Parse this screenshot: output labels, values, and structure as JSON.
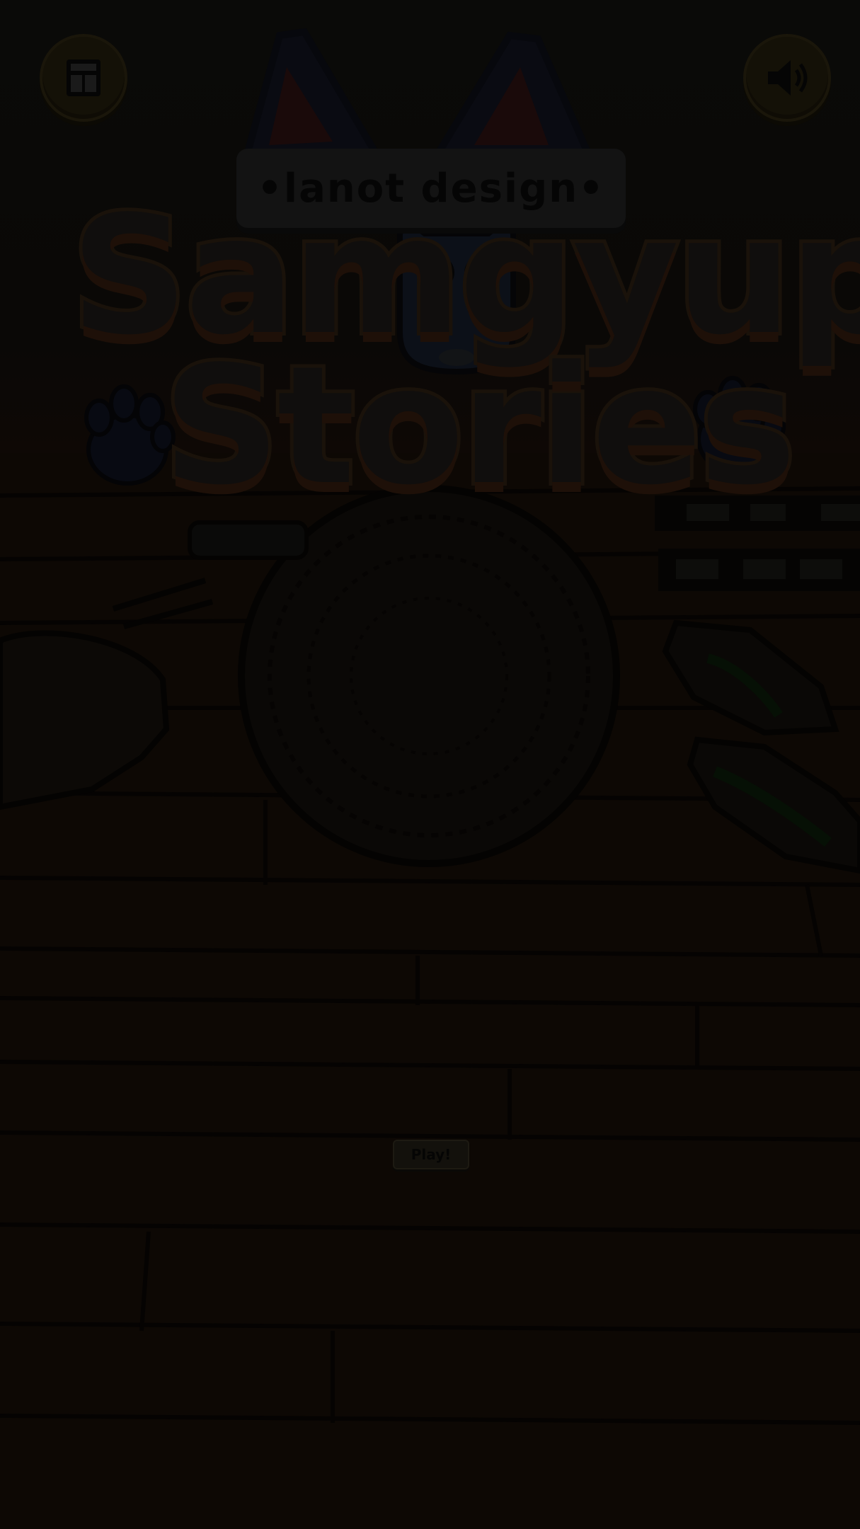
{
  "game": {
    "subtitle": "•lanot design•",
    "title_line1": "Samgyup",
    "title_line2": "Stories",
    "play_button_label": "Play!"
  },
  "controls": {
    "left_button_icon": "menu-card-icon",
    "right_button_icon": "speaker-volume-icon"
  },
  "colors": {
    "overlay": "#050302",
    "button": "#141107",
    "title_fill": "#100e0d"
  }
}
